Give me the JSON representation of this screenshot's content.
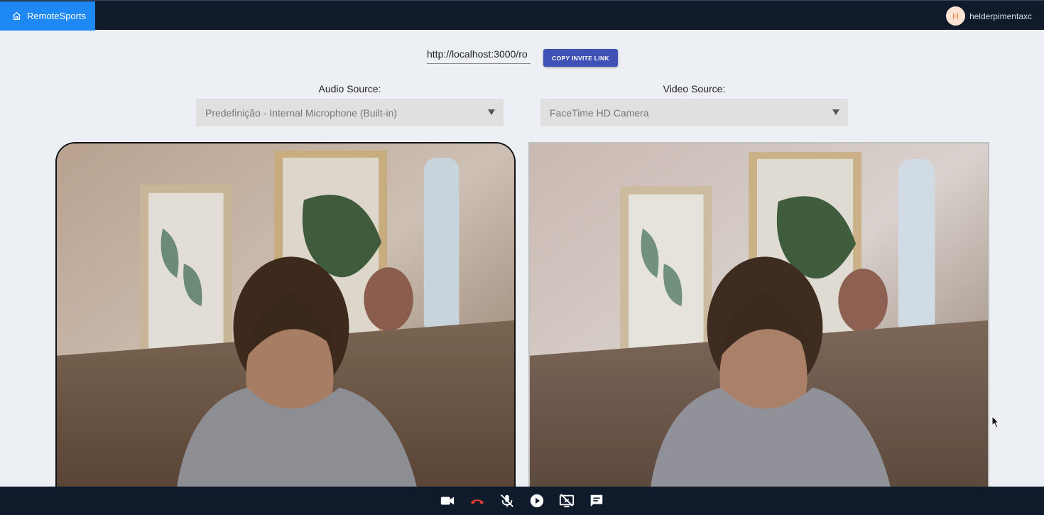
{
  "header": {
    "brand": "RemoteSports",
    "brand_icon": "home-icon",
    "user_initial": "H",
    "username": "helderpimentaxc"
  },
  "invite": {
    "link_value": "http://localhost:3000/ro",
    "copy_label": "COPY INVITE LINK"
  },
  "sources": {
    "audio_label": "Audio Source:",
    "audio_value": "Predefinição - Internal Microphone (Built-in)",
    "video_label": "Video Source:",
    "video_value": "FaceTime HD Camera"
  },
  "controls": [
    {
      "name": "camera-toggle",
      "icon": "video-camera-icon"
    },
    {
      "name": "end-call",
      "icon": "hang-up-icon"
    },
    {
      "name": "mute-mic",
      "icon": "mic-off-icon"
    },
    {
      "name": "play",
      "icon": "play-circle-icon"
    },
    {
      "name": "screen-share-off",
      "icon": "screen-share-off-icon"
    },
    {
      "name": "chat",
      "icon": "chat-icon"
    }
  ],
  "colors": {
    "topbar": "#0f1a2b",
    "brand": "#1e88f5",
    "accent_button": "#3f51b5",
    "hangup": "#e53935"
  }
}
